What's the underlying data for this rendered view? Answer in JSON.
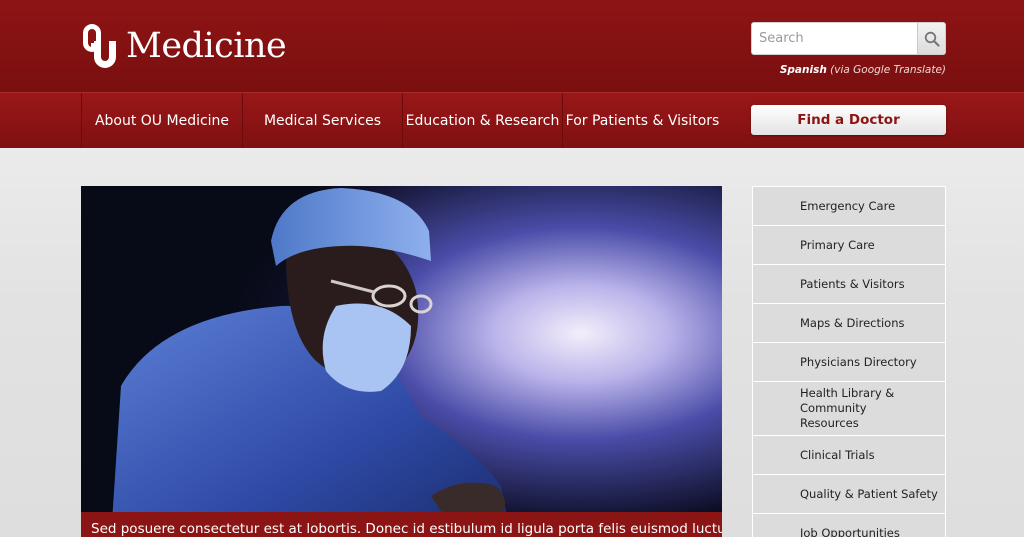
{
  "header": {
    "logo_text": "Medicine",
    "logo_mark": "OU",
    "search_placeholder": "Search",
    "translate_strong": "Spanish",
    "translate_rest": " (via Google Translate)"
  },
  "nav": {
    "items": [
      {
        "label": "About OU Medicine"
      },
      {
        "label": "Medical Services"
      },
      {
        "label": "Education & Research"
      },
      {
        "label": "For Patients & Visitors"
      }
    ],
    "find_doctor": "Find a Doctor"
  },
  "hero": {
    "caption": "Sed posuere consectetur est at lobortis. Donec id estibulum id ligula porta felis euismod luctus, nisi erat"
  },
  "sidebar": {
    "items": [
      {
        "label": "Emergency Care"
      },
      {
        "label": "Primary Care"
      },
      {
        "label": "Patients & Visitors"
      },
      {
        "label": "Maps & Directions"
      },
      {
        "label": "Physicians Directory"
      },
      {
        "label": "Health Library & Community Resources"
      },
      {
        "label": "Clinical Trials"
      },
      {
        "label": "Quality & Patient Safety"
      },
      {
        "label": "Job Opportunities"
      }
    ]
  },
  "colors": {
    "brand": "#8e1414",
    "nav": "#861213",
    "sidebar_bg": "#dcdcdc"
  }
}
